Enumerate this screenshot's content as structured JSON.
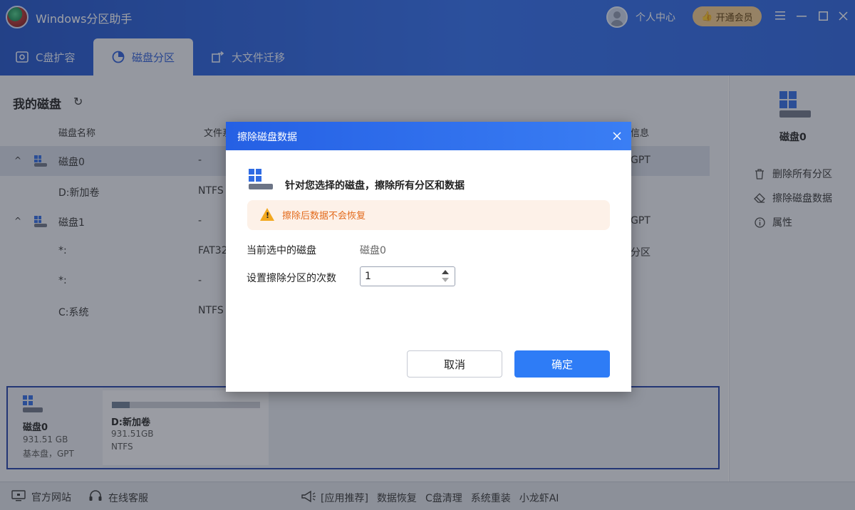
{
  "app": {
    "title": "Windows分区助手",
    "user_center": "个人中心",
    "vip": "开通会员"
  },
  "window": {
    "menu_icon": "menu-icon",
    "minimize_icon": "minimize-icon",
    "maximize_icon": "maximize-icon",
    "close_icon": "close-icon"
  },
  "tabs": [
    {
      "label": "C盘扩容",
      "icon": "drive-icon"
    },
    {
      "label": "磁盘分区",
      "icon": "pie-chart-icon",
      "active": true
    },
    {
      "label": "大文件迁移",
      "icon": "transfer-icon"
    }
  ],
  "disks_section": {
    "title": "我的磁盘",
    "columns": {
      "name": "磁盘名称",
      "fs": "文件系",
      "info": "信息"
    },
    "rows": [
      {
        "name": "磁盘0",
        "fs": "-",
        "info": "GPT",
        "selected": true,
        "expanded": true
      },
      {
        "name": "D:新加卷",
        "fs": "NTFS",
        "info": ""
      },
      {
        "name": "磁盘1",
        "fs": "-",
        "info": "GPT",
        "expanded": true
      },
      {
        "name": "*:",
        "fs": "FAT32",
        "info": "分区"
      },
      {
        "name": "*:",
        "fs": "-",
        "info": ""
      },
      {
        "name": "C:系统",
        "fs": "NTFS",
        "info": ""
      }
    ]
  },
  "right_panel": {
    "disk_label": "磁盘0",
    "actions": [
      {
        "label": "删除所有分区",
        "icon": "trash-icon"
      },
      {
        "label": "擦除磁盘数据",
        "icon": "eraser-icon"
      },
      {
        "label": "属性",
        "icon": "info-icon"
      }
    ]
  },
  "disk_map": {
    "disk": {
      "name": "磁盘0",
      "size": "931.51 GB",
      "type": "基本盘，GPT"
    },
    "partition": {
      "name": "D:新加卷",
      "size": "931.51GB",
      "fs": "NTFS",
      "used_fraction": 0.12
    }
  },
  "footer": {
    "website": "官方网站",
    "support": "在线客服",
    "recommend": "[应用推荐]",
    "links": [
      "数据恢复",
      "C盘清理",
      "系统重装",
      "小龙虾AI"
    ]
  },
  "dialog": {
    "title": "擦除磁盘数据",
    "description": "针对您选择的磁盘，擦除所有分区和数据",
    "warning": "擦除后数据不会恢复",
    "selected_disk_label": "当前选中的磁盘",
    "selected_disk_value": "磁盘0",
    "wipe_times_label": "设置擦除分区的次数",
    "wipe_times_value": "1",
    "cancel": "取消",
    "ok": "确定"
  },
  "colors": {
    "header_blue": "#2a63e0",
    "primary": "#2e7cf6",
    "warning_text": "#e36a1b",
    "warning_bg": "#fdf1e8"
  }
}
